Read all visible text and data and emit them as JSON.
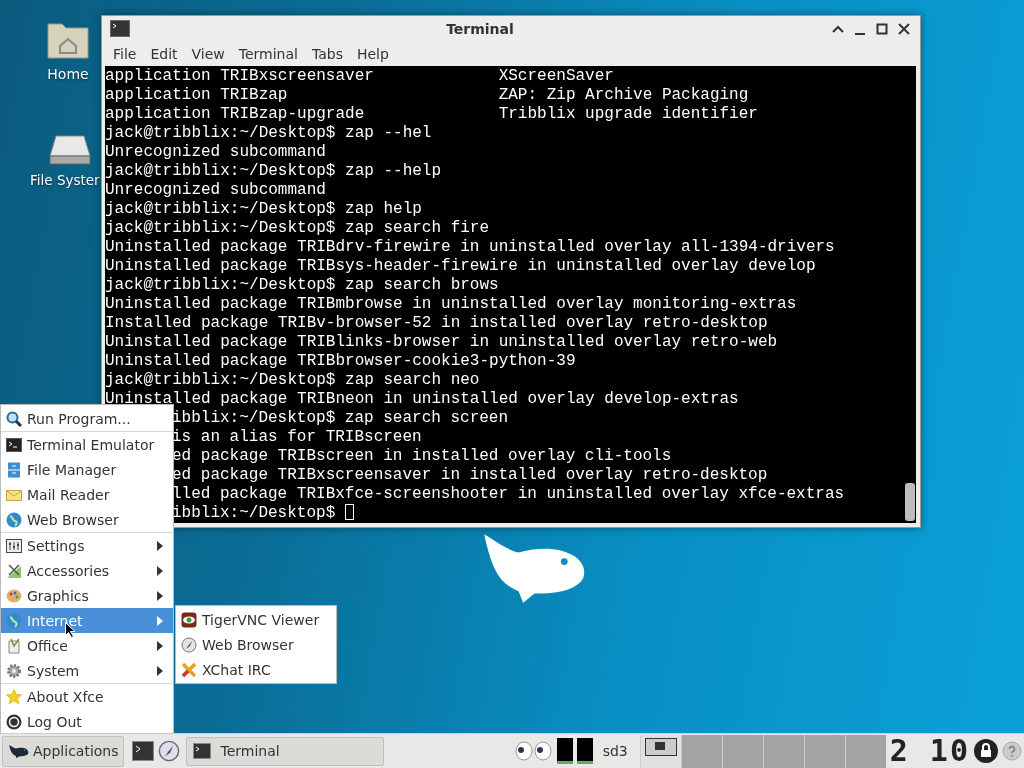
{
  "desktop_icons": [
    {
      "label": "Home"
    },
    {
      "label": "File Syster"
    }
  ],
  "terminal": {
    "title": "Terminal",
    "menu": [
      "File",
      "Edit",
      "View",
      "Terminal",
      "Tabs",
      "Help"
    ],
    "lines": [
      {
        "text": "application TRIBxscreensaver             XScreenSaver",
        "covered": false
      },
      {
        "text": "application TRIBzap                      ZAP: Zip Archive Packaging",
        "covered": false
      },
      {
        "text": "application TRIBzap-upgrade              Tribblix upgrade identifier",
        "covered": false
      },
      {
        "text": "jack@tribblix:~/Desktop$ zap --hel",
        "covered": false
      },
      {
        "text": "Unrecognized subcommand",
        "covered": false
      },
      {
        "text": "jack@tribblix:~/Desktop$ zap --help",
        "covered": false
      },
      {
        "text": "Unrecognized subcommand",
        "covered": false
      },
      {
        "text": "jack@tribblix:~/Desktop$ zap help",
        "covered": false
      },
      {
        "text": "jack@tribblix:~/Desktop$ zap search fire",
        "covered": false
      },
      {
        "text": "Uninstalled package TRIBdrv-firewire in uninstalled overlay all-1394-drivers",
        "covered": false
      },
      {
        "text": "Uninstalled package TRIBsys-header-firewire in uninstalled overlay develop",
        "covered": false
      },
      {
        "text": "jack@tribblix:~/Desktop$ zap search brows",
        "covered": false
      },
      {
        "text": "Uninstalled package TRIBmbrowse in uninstalled overlay monitoring-extras",
        "covered": false
      },
      {
        "text": "Installed package TRIBv-browser-52 in installed overlay retro-desktop",
        "covered": false
      },
      {
        "text": "Uninstalled package TRIBlinks-browser in uninstalled overlay retro-web",
        "covered": false
      },
      {
        "text": "Uninstalled package TRIBbrowser-cookie3-python-39",
        "covered": false
      },
      {
        "text": "jack@tribblix:~/Desktop$ zap search neo",
        "covered": false
      },
      {
        "text": "Uninstalled package TRIBneon in uninstalled overlay develop-extras",
        "covered": false
      },
      {
        "text": "ibblix:~/Desktop$ zap search screen",
        "covered": true
      },
      {
        "text": "is an alias for TRIBscreen",
        "covered": true
      },
      {
        "text": "ed package TRIBscreen in installed overlay cli-tools",
        "covered": true
      },
      {
        "text": "ed package TRIBxscreensaver in installed overlay retro-desktop",
        "covered": true
      },
      {
        "text": "lled package TRIBxfce-screenshooter in uninstalled overlay xfce-extras",
        "covered": true
      },
      {
        "text": "ibblix:~/Desktop$ ",
        "covered": true
      }
    ]
  },
  "app_menu": {
    "groups": [
      {
        "items": [
          {
            "label": "Run Program...",
            "submenu": false,
            "selected": false
          }
        ]
      },
      {
        "items": [
          {
            "label": "Terminal Emulator",
            "submenu": false,
            "selected": false
          },
          {
            "label": "File Manager",
            "submenu": false,
            "selected": false
          },
          {
            "label": "Mail Reader",
            "submenu": false,
            "selected": false
          },
          {
            "label": "Web Browser",
            "submenu": false,
            "selected": false
          }
        ]
      },
      {
        "items": [
          {
            "label": "Settings",
            "submenu": true,
            "selected": false
          },
          {
            "label": "Accessories",
            "submenu": true,
            "selected": false
          },
          {
            "label": "Graphics",
            "submenu": true,
            "selected": false
          },
          {
            "label": "Internet",
            "submenu": true,
            "selected": true
          },
          {
            "label": "Office",
            "submenu": true,
            "selected": false
          },
          {
            "label": "System",
            "submenu": true,
            "selected": false
          }
        ]
      },
      {
        "items": [
          {
            "label": "About Xfce",
            "submenu": false,
            "selected": false
          },
          {
            "label": "Log Out",
            "submenu": false,
            "selected": false
          }
        ]
      }
    ]
  },
  "submenu": {
    "items": [
      {
        "label": "TigerVNC Viewer"
      },
      {
        "label": "Web Browser"
      },
      {
        "label": "XChat IRC"
      }
    ]
  },
  "taskbar": {
    "applications": "Applications",
    "task": "Terminal",
    "device": "sd3",
    "clock": "2 10"
  }
}
